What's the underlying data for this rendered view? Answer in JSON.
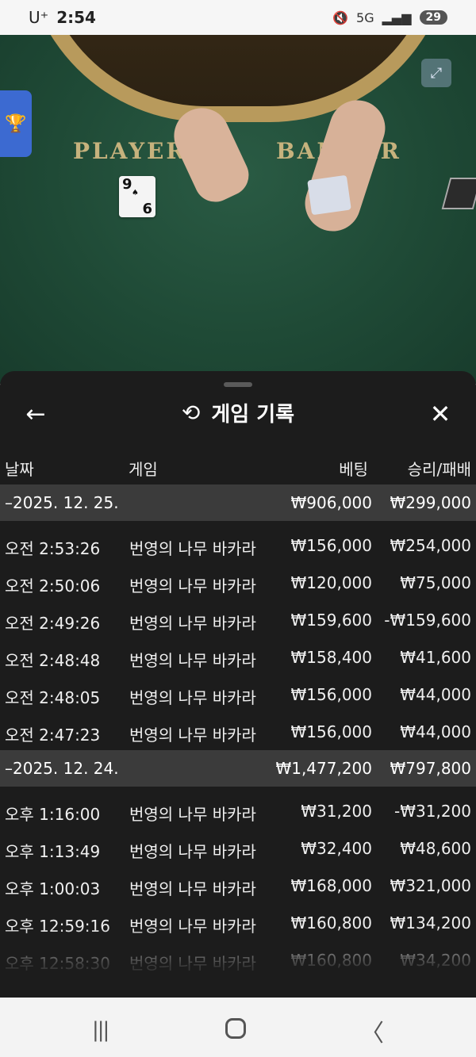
{
  "status_bar": {
    "carrier": "U⁺",
    "time": "2:54",
    "network": "5G",
    "battery": "29"
  },
  "video": {
    "player_label": "PLAYER",
    "banker_label": "BANKER",
    "player_card_top": "9",
    "player_card_bottom": "6"
  },
  "sheet": {
    "title": "게임 기록",
    "columns": {
      "date": "날짜",
      "game": "게임",
      "bet": "베팅",
      "win_loss": "승리/패배"
    },
    "groups": [
      {
        "date": "–2025. 12. 25.",
        "bet_total": "₩906,000",
        "win_total": "₩299,000",
        "rows": [
          {
            "time": "오전 2:53:26",
            "game": "번영의 나무 바카라",
            "bet": "₩156,000",
            "win": "₩254,000"
          },
          {
            "time": "오전 2:50:06",
            "game": "번영의 나무 바카라",
            "bet": "₩120,000",
            "win": "₩75,000"
          },
          {
            "time": "오전 2:49:26",
            "game": "번영의 나무 바카라",
            "bet": "₩159,600",
            "win": "-₩159,600"
          },
          {
            "time": "오전 2:48:48",
            "game": "번영의 나무 바카라",
            "bet": "₩158,400",
            "win": "₩41,600"
          },
          {
            "time": "오전 2:48:05",
            "game": "번영의 나무 바카라",
            "bet": "₩156,000",
            "win": "₩44,000"
          },
          {
            "time": "오전 2:47:23",
            "game": "번영의 나무 바카라",
            "bet": "₩156,000",
            "win": "₩44,000"
          }
        ]
      },
      {
        "date": "–2025. 12. 24.",
        "bet_total": "₩1,477,200",
        "win_total": "₩797,800",
        "rows": [
          {
            "time": "오후 1:16:00",
            "game": "번영의 나무 바카라",
            "bet": "₩31,200",
            "win": "-₩31,200"
          },
          {
            "time": "오후 1:13:49",
            "game": "번영의 나무 바카라",
            "bet": "₩32,400",
            "win": "₩48,600"
          },
          {
            "time": "오후 1:00:03",
            "game": "번영의 나무 바카라",
            "bet": "₩168,000",
            "win": "₩321,000"
          },
          {
            "time": "오후 12:59:16",
            "game": "번영의 나무 바카라",
            "bet": "₩160,800",
            "win": "₩134,200"
          },
          {
            "time": "오후 12:58:30",
            "game": "번영의 나무 바카라",
            "bet": "₩160,800",
            "win": "₩34,200"
          }
        ]
      }
    ]
  },
  "colors": {
    "sheet_bg": "#1c1c1c",
    "group_row_bg": "#3b3b3b",
    "table_felt": "#1f4a36",
    "accent_blue": "#3c6ad1"
  },
  "icons": {
    "back": "arrow-left-icon",
    "history": "history-icon",
    "close": "close-icon",
    "trophy": "trophy-icon",
    "expand": "expand-icon"
  }
}
